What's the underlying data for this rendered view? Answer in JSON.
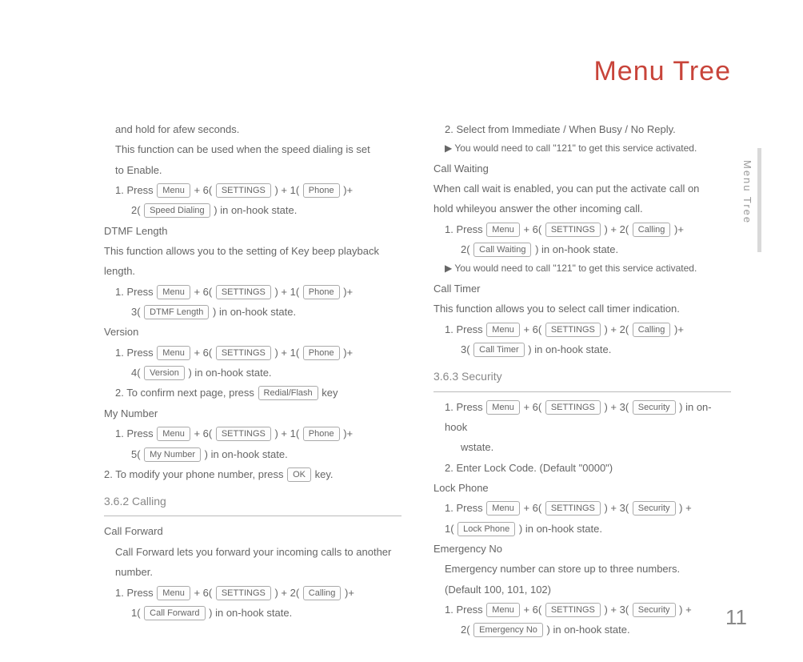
{
  "title": "Menu Tree",
  "side_label": "Menu Tree",
  "page_number": "11",
  "keys": {
    "menu": "Menu",
    "settings": "SETTINGS",
    "phone": "Phone",
    "speed_dialing": "Speed Dialing",
    "dtmf_length": "DTMF Length",
    "version": "Version",
    "redial_flash": "Redial/Flash",
    "my_number": "My Number",
    "ok": "OK",
    "calling": "Calling",
    "call_forward": "Call Forward",
    "call_waiting": "Call Waiting",
    "call_timer": "Call Timer",
    "security": "Security",
    "lock_phone": "Lock Phone",
    "emergency_no": "Emergency No"
  },
  "left": {
    "l1": "and hold for afew seconds.",
    "l2": "This function can be used when the speed dialing is set",
    "l3": "to Enable.",
    "l4a": "1. Press ",
    "l4b": " + 6( ",
    "l4c": " ) + 1( ",
    "l4d": " )+",
    "l5a": "2( ",
    "l5b": " ) in on-hook state.",
    "dtmf_h": "DTMF Length",
    "dtmf_1": "This function allows you to the setting of Key beep playback",
    "dtmf_2": "length.",
    "dtmf_3a": "1. Press ",
    "dtmf_3b": " + 6( ",
    "dtmf_3c": " ) + 1( ",
    "dtmf_3d": " )+",
    "dtmf_4a": "3( ",
    "dtmf_4b": " ) in on-hook state.",
    "ver_h": "Version",
    "ver_1a": "1. Press ",
    "ver_1b": " + 6( ",
    "ver_1c": " ) + 1( ",
    "ver_1d": " )+",
    "ver_2a": "4( ",
    "ver_2b": " ) in on-hook state.",
    "ver_3a": "2. To confirm next page, press ",
    "ver_3b": " key",
    "myn_h": "My Number",
    "myn_1a": "1. Press ",
    "myn_1b": " + 6( ",
    "myn_1c": " ) + 1( ",
    "myn_1d": " )+",
    "myn_2a": "5( ",
    "myn_2b": " ) in on-hook state.",
    "myn_3a": "2. To modify your phone number, press ",
    "myn_3b": " key.",
    "s362": "3.6.2  Calling",
    "cf_h": "Call Forward",
    "cf_1": "Call Forward lets you forward your incoming calls to another",
    "cf_2": "number.",
    "cf_3a": "1. Press ",
    "cf_3b": " + 6( ",
    "cf_3c": " ) + 2( ",
    "cf_3d": " )+",
    "cf_4a": "1( ",
    "cf_4b": " ) in on-hook state."
  },
  "right": {
    "r1": "2. Select from Immediate / When Busy / No Reply.",
    "r2": "▶ You would need to call \"121\" to get this service activated.",
    "cw_h": "Call Waiting",
    "cw_1": "When call wait is enabled, you can put the activate call on",
    "cw_2": "hold whileyou answer the other incoming call.",
    "cw_3a": "1. Press ",
    "cw_3b": " + 6( ",
    "cw_3c": " ) + 2( ",
    "cw_3d": " )+",
    "cw_4a": "2( ",
    "cw_4b": " ) in on-hook state.",
    "cw_5": "▶ You would need to call \"121\" to get this service activated.",
    "ct_h": "Call Timer",
    "ct_1": "This function allows you to select call timer indication.",
    "ct_2a": "1. Press ",
    "ct_2b": " + 6( ",
    "ct_2c": " ) + 2( ",
    "ct_2d": " )+",
    "ct_3a": "3( ",
    "ct_3b": " ) in on-hook state.",
    "s363": "3.6.3  Security",
    "sec_1a": "1. Press ",
    "sec_1b": " + 6( ",
    "sec_1c": " ) + 3( ",
    "sec_1d": " ) in on-hook",
    "sec_1e": "wstate.",
    "sec_2": "2. Enter Lock Code. (Default \"0000\")",
    "lp_h": "Lock Phone",
    "lp_1a": "1. Press ",
    "lp_1b": " + 6( ",
    "lp_1c": " ) + 3( ",
    "lp_1d": " ) +",
    "lp_2a": "1( ",
    "lp_2b": " ) in on-hook state.",
    "en_h": "Emergency No",
    "en_1": "Emergency number can store up to three numbers.",
    "en_2": "(Default 100, 101, 102)",
    "en_3a": "1. Press ",
    "en_3b": " + 6( ",
    "en_3c": " ) + 3( ",
    "en_3d": " ) +",
    "en_4a": "2( ",
    "en_4b": " ) in on-hook state."
  }
}
